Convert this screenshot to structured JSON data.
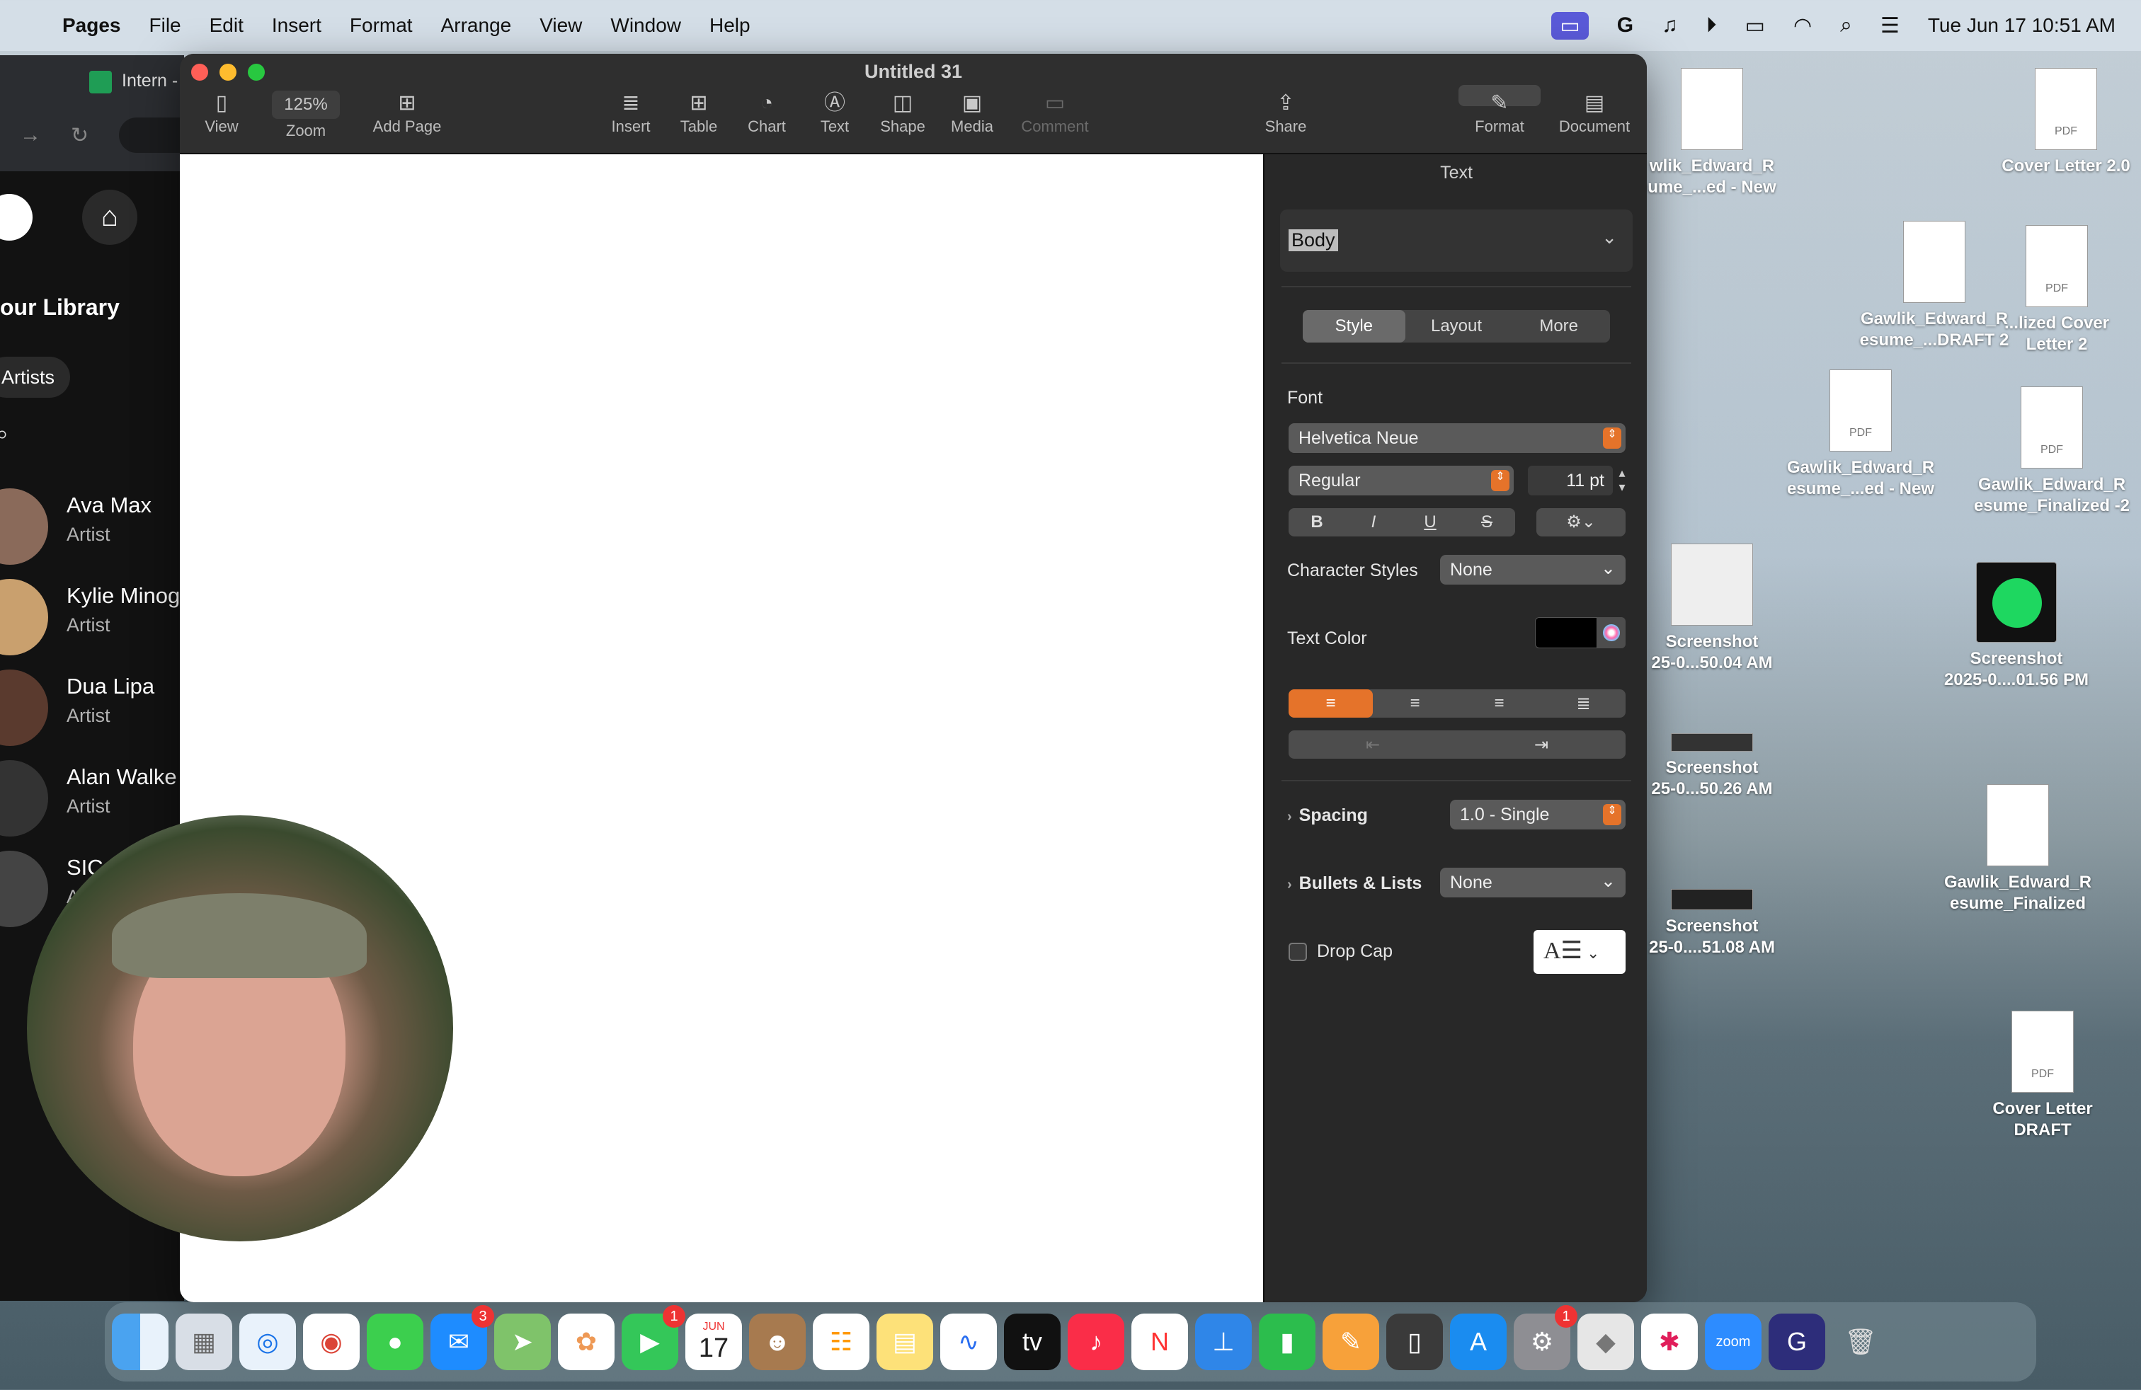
{
  "menubar": {
    "app": "Pages",
    "items": [
      "File",
      "Edit",
      "Insert",
      "Format",
      "Arrange",
      "View",
      "Window",
      "Help"
    ],
    "clock": "Tue Jun 17  10:51 AM"
  },
  "bg_browser": {
    "tab": "Intern -",
    "library": "our Library",
    "chip": "Artists",
    "artists": [
      {
        "name": "Ava Max",
        "type": "Artist"
      },
      {
        "name": "Kylie Minog",
        "type": "Artist"
      },
      {
        "name": "Dua Lipa",
        "type": "Artist"
      },
      {
        "name": "Alan Walke",
        "type": "Artist"
      },
      {
        "name": "SIC",
        "type": "A"
      }
    ]
  },
  "window": {
    "title": "Untitled 31",
    "toolbar": {
      "view": "View",
      "zoom_value": "125%",
      "zoom": "Zoom",
      "add_page": "Add Page",
      "insert": "Insert",
      "table": "Table",
      "chart": "Chart",
      "text": "Text",
      "shape": "Shape",
      "media": "Media",
      "comment": "Comment",
      "share": "Share",
      "format": "Format",
      "document": "Document"
    }
  },
  "inspector": {
    "header": "Text",
    "paragraph_style": "Body",
    "tabs": [
      "Style",
      "Layout",
      "More"
    ],
    "font_label": "Font",
    "font_family": "Helvetica Neue",
    "font_weight": "Regular",
    "font_size": "11 pt",
    "bius": [
      "B",
      "I",
      "U",
      "S"
    ],
    "char_styles_label": "Character Styles",
    "char_styles_value": "None",
    "text_color_label": "Text Color",
    "spacing_label": "Spacing",
    "spacing_value": "1.0 - Single",
    "bullets_label": "Bullets & Lists",
    "bullets_value": "None",
    "dropcap_label": "Drop Cap"
  },
  "desktop": [
    {
      "label1": "wlik_Edward_R",
      "label2": "ume_...ed - New"
    },
    {
      "label1": "Cover Letter 2.0",
      "label2": ""
    },
    {
      "label1": "Gawlik_Edward_R",
      "label2": "esume_...DRAFT 2"
    },
    {
      "label1": "...lized Cover",
      "label2": "Letter 2"
    },
    {
      "label1": "Gawlik_Edward_R",
      "label2": "esume_...ed - New"
    },
    {
      "label1": "Gawlik_Edward_R",
      "label2": "esume_Finalized -2"
    },
    {
      "label1": "Screenshot",
      "label2": "25-0...50.04 AM"
    },
    {
      "label1": "Screenshot",
      "label2": "2025-0....01.56 PM"
    },
    {
      "label1": "Screenshot",
      "label2": "25-0...50.26 AM"
    },
    {
      "label1": "Gawlik_Edward_R",
      "label2": "esume_Finalized"
    },
    {
      "label1": "Screenshot",
      "label2": "25-0....51.08 AM"
    },
    {
      "label1": "Cover Letter",
      "label2": "DRAFT"
    }
  ],
  "dock": {
    "mail_badge": "3",
    "facetime_badge": "1",
    "settings_badge": "1",
    "calendar_month": "JUN",
    "calendar_day": "17"
  }
}
